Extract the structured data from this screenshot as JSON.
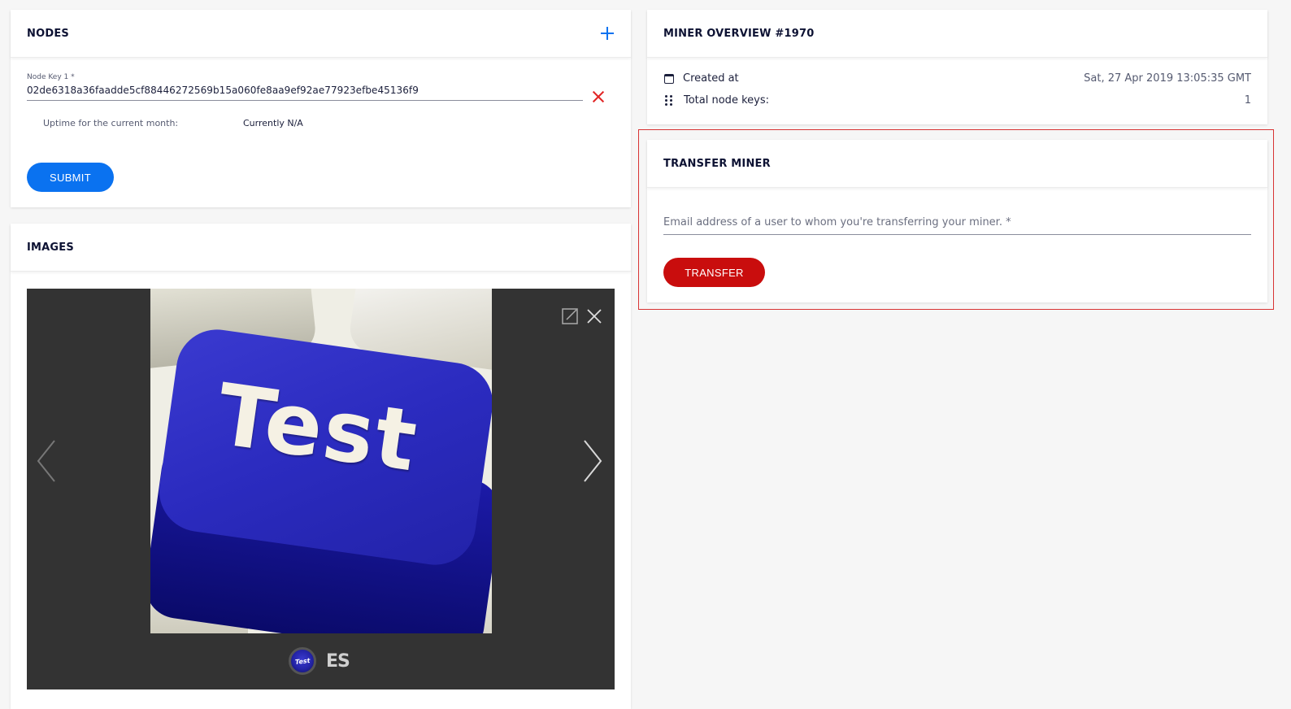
{
  "nodes": {
    "title": "NODES",
    "add_icon": "plus-icon",
    "field_label": "Node Key 1 *",
    "node_key": "02de6318a36faadde5cf88446272569b15a060fe8aa9ef92ae77923efbe45136f9",
    "remove_icon": "close-icon",
    "uptime_label": "Uptime for the current month:",
    "uptime_value": "Currently N/A",
    "submit_label": "SUBMIT",
    "accent_color": "#0a72f0"
  },
  "images": {
    "title": "IMAGES",
    "main_image_text": "Test",
    "thumbnails": [
      {
        "text": "Test",
        "icon": "test-key-thumbnail"
      },
      {
        "text": "ES",
        "icon": "es-thumbnail"
      }
    ],
    "controls": [
      "chevron-left-icon",
      "chevron-right-icon",
      "expand-icon",
      "close-icon"
    ]
  },
  "overview": {
    "title": "MINER OVERVIEW #1970",
    "rows": [
      {
        "icon": "calendar-icon",
        "label": "Created at",
        "value": "Sat, 27 Apr 2019 13:05:35 GMT"
      },
      {
        "icon": "grid-dots-icon",
        "label": "Total node keys:",
        "value": "1"
      }
    ]
  },
  "transfer": {
    "title": "TRANSFER MINER",
    "email_placeholder": "Email address of a user to whom you're transferring your miner. *",
    "button_label": "TRANSFER",
    "accent_color": "#c90d0d"
  }
}
